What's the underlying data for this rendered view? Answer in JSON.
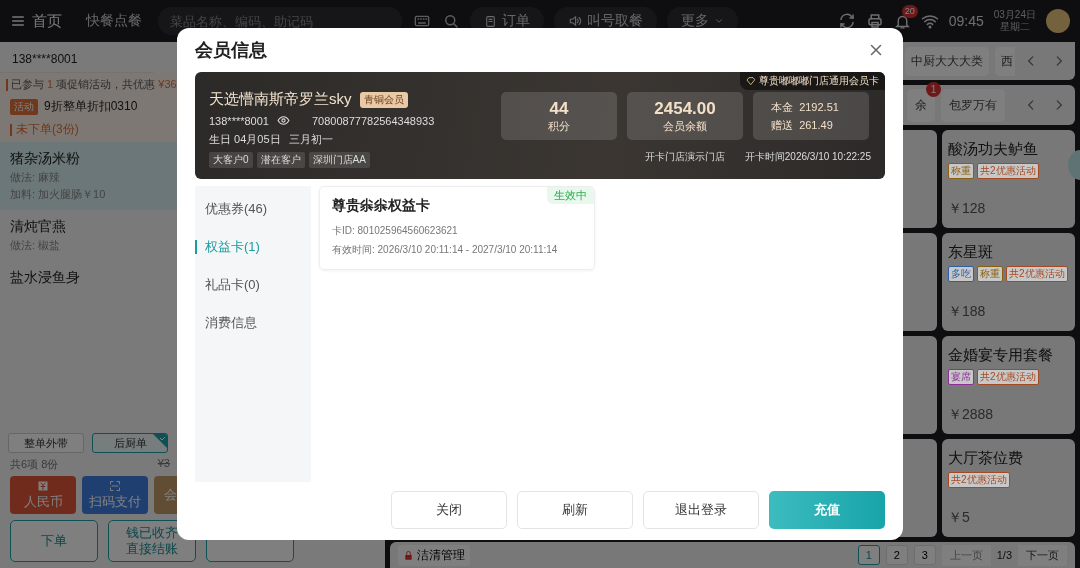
{
  "top_bar": {
    "home": "首页",
    "mode": "快餐点餐",
    "search": {
      "placeholder": "菜品名称、编码、助记码"
    },
    "buttons": [
      {
        "kind": "order",
        "label": "订单"
      },
      {
        "kind": "call",
        "label": "叫号取餐"
      },
      {
        "kind": "more",
        "label": "更多"
      }
    ],
    "notification_count": "20",
    "time": "09:45",
    "date": "03月24日",
    "weekday": "星期二"
  },
  "order_panel": {
    "member_phone": "138****8001",
    "promo": {
      "prefix": "已参与",
      "count": "1",
      "middle": "项促销活动，共优惠",
      "amount": "¥36"
    },
    "activity": {
      "tag": "活动",
      "text": "9折整单折扣0310"
    },
    "section": "未下单(3份)",
    "items": [
      {
        "name": "猪杂汤米粉",
        "selected": true,
        "details": [
          "做法:  麻辣",
          "加料:  加火腿肠￥10"
        ]
      },
      {
        "name": "清炖官燕",
        "selected": false,
        "details": [
          "做法:  椒盐"
        ]
      },
      {
        "name": "盐水浸鱼身",
        "selected": false
      }
    ],
    "toggles": [
      {
        "label": "整单外带",
        "checked": false
      },
      {
        "label": "后厨单",
        "checked": true
      }
    ],
    "summary": "共6项 8份",
    "total": "¥3",
    "payments": [
      {
        "kind": "cash",
        "label": "人民币"
      },
      {
        "kind": "scan",
        "label": "扫码支付"
      },
      {
        "kind": "member",
        "label": "会"
      }
    ],
    "actions": [
      {
        "kind": "text",
        "lines": [
          "下单"
        ]
      },
      {
        "kind": "text",
        "lines": [
          "钱已收齐",
          "直接结账"
        ]
      },
      {
        "kind": "covered"
      }
    ]
  },
  "menu": {
    "categories": [
      {
        "label": "中厨大大大类",
        "selected": false
      },
      {
        "label": "西",
        "selected": false
      }
    ],
    "subcategories": [
      {
        "label": "余",
        "badge": "1"
      },
      {
        "label": "包罗万有"
      }
    ],
    "dishes": [
      {
        "name": "酸汤功夫鲈鱼",
        "price": "￥128",
        "tags": [
          {
            "label": "称重",
            "color": "#8a5f10"
          },
          {
            "label": "共2优惠活动",
            "color": "#a34a22"
          }
        ]
      },
      {
        "name": "东星斑",
        "price": "￥188",
        "tags": [
          {
            "label": "多吃",
            "color": "#2d5fa8"
          },
          {
            "label": "称重",
            "color": "#8a5f10"
          },
          {
            "label": "共2优惠活动",
            "color": "#a34a22"
          }
        ]
      },
      {
        "name": "金婚宴专用套餐",
        "price": "￥2888",
        "tags": [
          {
            "label": "宴席",
            "color": "#8e2f99"
          },
          {
            "label": "共2优惠活动",
            "color": "#a34a22"
          }
        ]
      },
      {
        "name": "大厅茶位费",
        "price": "￥5",
        "tags": [
          {
            "label": "共2优惠活动",
            "color": "#a34a22"
          }
        ]
      }
    ],
    "footer": {
      "manage": "洁清管理",
      "pages": [
        {
          "label": "1",
          "selected": true
        },
        {
          "label": "2",
          "selected": false
        },
        {
          "label": "3",
          "selected": false
        }
      ],
      "prev": {
        "label": "上一页",
        "disabled": true
      },
      "page_info": "1/3",
      "next": {
        "label": "下一页",
        "disabled": false
      }
    }
  },
  "dialog": {
    "title": "会员信息",
    "member": {
      "name": "天选懵南斯帝罗兰sky",
      "level": "青铜会员",
      "phone": "138****8001",
      "card_number": "70800877782564348933",
      "birthday": "生日 04月05日",
      "lunar": "三月初一",
      "tags": [
        "大客户0",
        "潜在客户",
        "深圳门店AA"
      ],
      "card_type": "尊贵嘟嘟嘟门店通用会员卡",
      "stats": [
        {
          "value": "44",
          "label": "积分"
        },
        {
          "value": "2454.00",
          "label": "会员余额"
        }
      ],
      "balance": [
        {
          "label": "本金",
          "value": "2192.51"
        },
        {
          "label": "赠送",
          "value": "261.49"
        }
      ],
      "store": "开卡门店演示门店",
      "opened": "开卡时间2026/3/10 10:22:25"
    },
    "nav": [
      {
        "label": "优惠券(46)",
        "selected": false
      },
      {
        "label": "权益卡(1)",
        "selected": true
      },
      {
        "label": "礼品卡(0)",
        "selected": false
      },
      {
        "label": "消费信息",
        "selected": false
      }
    ],
    "cards": [
      {
        "title": "尊贵尜尜权益卡",
        "status": "生效中",
        "id_label": "卡ID:",
        "id": "801025964560623621",
        "validity_label": "有效时间:",
        "validity": "2026/3/10 20:11:14 - 2027/3/10 20:11:14"
      }
    ],
    "buttons": [
      {
        "label": "关闭",
        "kind": "default"
      },
      {
        "label": "刷新",
        "kind": "default"
      },
      {
        "label": "退出登录",
        "kind": "default"
      },
      {
        "label": "充值",
        "kind": "primary"
      }
    ]
  }
}
